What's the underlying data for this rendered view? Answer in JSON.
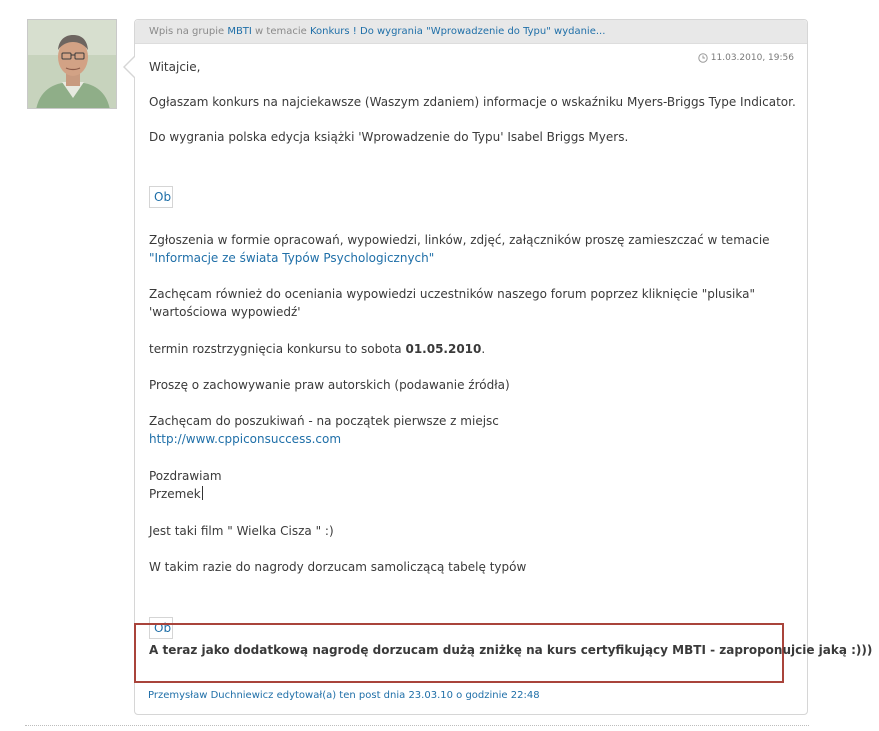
{
  "post": {
    "header": {
      "prefix": "Wpis na grupie",
      "group": "MBTI",
      "middle": "w temacie",
      "topic": "Konkurs ! Do wygrania \"Wprowadzenie do Typu\" wydanie..."
    },
    "date": "11.03.2010, 19:56",
    "lines": {
      "greeting": "Witajcie,",
      "announce": "Ogłaszam konkurs na najciekawsze (Waszym zdaniem) informacje o wskaźniku Myers-Briggs Type Indicator.",
      "prize": "Do wygrania polska edycja książki 'Wprowadzenie do Typu' Isabel Briggs Myers.",
      "image1": "Ob",
      "submissions": "Zgłoszenia w formie opracowań, wypowiedzi, linków, zdjęć, załączników proszę zamieszczać w temacie",
      "submissions_link": "\"Informacje ze świata Typów Psychologicznych\"",
      "rating1": "Zachęcam również do oceniania wypowiedzi uczestników naszego forum poprzez kliknięcie \"plusika\"",
      "rating2": "'wartościowa wypowiedź'",
      "deadline_prefix": "termin rozstrzygnięcia konkursu to sobota",
      "deadline_date": "01.05.2010",
      "deadline_suffix": ".",
      "copyright": "Proszę o zachowywanie praw autorskich (podawanie źródła)",
      "search": "Zachęcam do poszukiwań - na początek pierwsze z miejsc",
      "search_link": "http://www.cppiconsuccess.com",
      "regards": "Pozdrawiam",
      "signature": "Przemek",
      "film": "Jest taki film \" Wielka Cisza \" :)",
      "table": "W takim razie do nagrody dorzucam samoliczącą tabelę typów",
      "image2": "Ob",
      "bonus": "A teraz jako dodatkową nagrodę dorzucam dużą zniżkę na kurs certyfikujący MBTI - zaproponujcie jaką :)))"
    },
    "edit_note": "Przemysław Duchniewicz edytował(a) ten post dnia 23.03.10 o godzinie 22:48"
  },
  "colors": {
    "link": "#1f6fa8",
    "highlight_border": "#a9443b",
    "header_bg": "#e8e8e8"
  },
  "icons": {
    "date": "clock-icon"
  }
}
